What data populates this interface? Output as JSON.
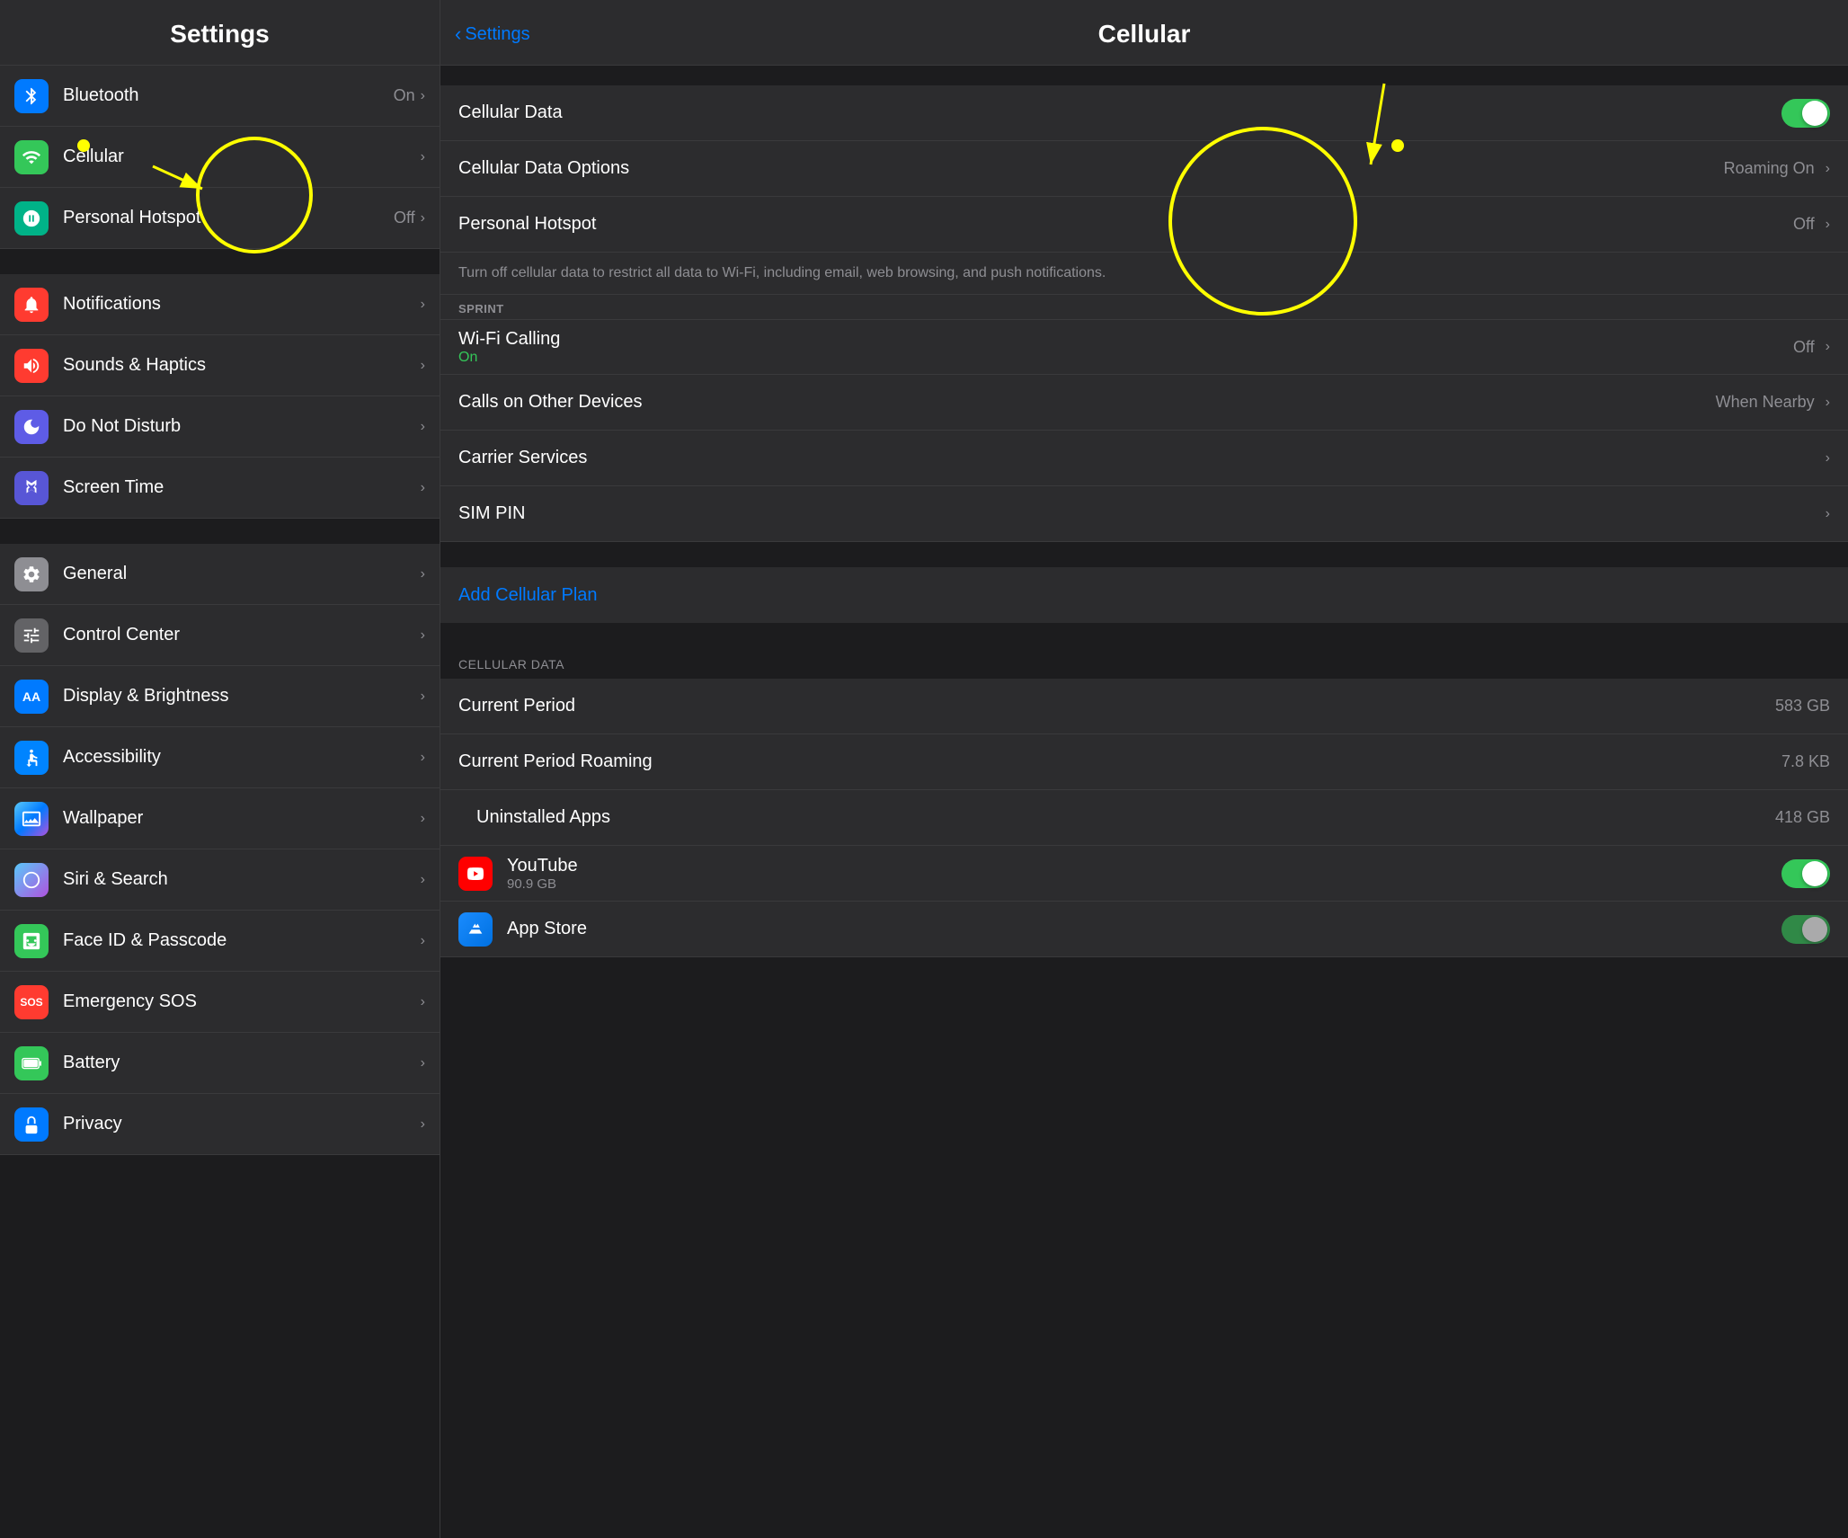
{
  "left": {
    "header": {
      "title": "Settings"
    },
    "sections": [
      {
        "items": [
          {
            "id": "bluetooth",
            "icon_bg": "blue",
            "icon": "bluetooth",
            "label": "Bluetooth",
            "value": "On",
            "chevron": true
          },
          {
            "id": "cellular",
            "icon_bg": "green",
            "icon": "cellular",
            "label": "Cellular",
            "value": "",
            "chevron": true,
            "annotated": true
          },
          {
            "id": "personal-hotspot",
            "icon_bg": "green2",
            "icon": "hotspot",
            "label": "Personal Hotspot",
            "value": "Off",
            "chevron": true
          }
        ]
      },
      {
        "items": [
          {
            "id": "notifications",
            "icon_bg": "red",
            "icon": "notification",
            "label": "Notifications",
            "value": "",
            "chevron": true
          },
          {
            "id": "sounds",
            "icon_bg": "red2",
            "icon": "sound",
            "label": "Sounds & Haptics",
            "value": "",
            "chevron": true
          },
          {
            "id": "do-not-disturb",
            "icon_bg": "purple",
            "icon": "moon",
            "label": "Do Not Disturb",
            "value": "",
            "chevron": true
          },
          {
            "id": "screen-time",
            "icon_bg": "indigo",
            "icon": "hourglass",
            "label": "Screen Time",
            "value": "",
            "chevron": true
          }
        ]
      },
      {
        "items": [
          {
            "id": "general",
            "icon_bg": "gray",
            "icon": "gear",
            "label": "General",
            "value": "",
            "chevron": true
          },
          {
            "id": "control-center",
            "icon_bg": "gray2",
            "icon": "sliders",
            "label": "Control Center",
            "value": "",
            "chevron": true
          },
          {
            "id": "display",
            "icon_bg": "blue2",
            "icon": "aa",
            "label": "Display & Brightness",
            "value": "",
            "chevron": true
          },
          {
            "id": "accessibility",
            "icon_bg": "blue3",
            "icon": "accessibility",
            "label": "Accessibility",
            "value": "",
            "chevron": true
          },
          {
            "id": "wallpaper",
            "icon_bg": "teal",
            "icon": "flower",
            "label": "Wallpaper",
            "value": "",
            "chevron": true
          },
          {
            "id": "siri",
            "icon_bg": "gradient",
            "icon": "siri",
            "label": "Siri & Search",
            "value": "",
            "chevron": true
          },
          {
            "id": "face-id",
            "icon_bg": "green3",
            "icon": "face",
            "label": "Face ID & Passcode",
            "value": "",
            "chevron": true
          },
          {
            "id": "emergency-sos",
            "icon_bg": "red3",
            "icon": "sos",
            "label": "Emergency SOS",
            "value": "",
            "chevron": true
          },
          {
            "id": "battery",
            "icon_bg": "green4",
            "icon": "battery",
            "label": "Battery",
            "value": "",
            "chevron": true
          },
          {
            "id": "privacy",
            "icon_bg": "blue4",
            "icon": "hand",
            "label": "Privacy",
            "value": "",
            "chevron": true,
            "partial": true
          }
        ]
      }
    ]
  },
  "right": {
    "header": {
      "back_label": "Settings",
      "title": "Cellular"
    },
    "sections": [
      {
        "items": [
          {
            "id": "cellular-data",
            "label": "Cellular Data",
            "toggle": true,
            "toggle_on": true
          },
          {
            "id": "cellular-data-options",
            "label": "Cellular Data Options",
            "value": "Roaming On",
            "chevron": true
          },
          {
            "id": "personal-hotspot",
            "label": "Personal Hotspot",
            "value": "Off",
            "chevron": true
          }
        ]
      },
      {
        "description": "Turn off cellular data to restrict all data to Wi-Fi, including email, web browsing, and push notifications.",
        "carrier": "SPRINT",
        "items": [
          {
            "id": "wifi-calling",
            "label": "Wi-Fi Calling",
            "sublabel": "On",
            "value": "Off",
            "chevron": true
          },
          {
            "id": "calls-other-devices",
            "label": "Calls on Other Devices",
            "value": "When Nearby",
            "chevron": true
          },
          {
            "id": "carrier-services",
            "label": "Carrier Services",
            "value": "",
            "chevron": true
          },
          {
            "id": "sim-pin",
            "label": "SIM PIN",
            "value": "",
            "chevron": true
          }
        ]
      },
      {
        "add_plan": true,
        "items": []
      },
      {
        "section_header": "CELLULAR DATA",
        "items": [
          {
            "id": "current-period",
            "label": "Current Period",
            "value": "583 GB"
          },
          {
            "id": "current-period-roaming",
            "label": "Current Period Roaming",
            "value": "7.8 KB"
          },
          {
            "id": "uninstalled-apps",
            "label": "Uninstalled Apps",
            "value": "418 GB",
            "indent": true
          },
          {
            "id": "youtube",
            "label": "YouTube",
            "sublabel": "90.9 GB",
            "toggle": true,
            "toggle_on": true,
            "app_icon": "youtube"
          },
          {
            "id": "app-store",
            "label": "App Store",
            "sublabel": "",
            "app_icon": "appstore",
            "partial": true
          }
        ]
      }
    ]
  },
  "annotations": {
    "circle_left": {
      "note": "Cellular icon highlighted"
    },
    "circle_right": {
      "note": "Toggle highlighted"
    }
  }
}
